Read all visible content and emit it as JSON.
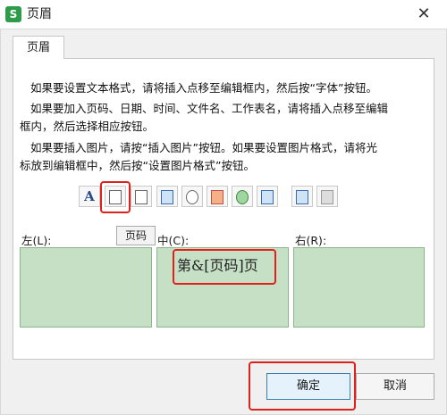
{
  "window": {
    "app_icon": "S",
    "title": "页眉",
    "close": "✕"
  },
  "tab": {
    "label": "页眉"
  },
  "instructions": [
    "如果要设置文本格式，请将插入点移至编辑框内，然后按“字体”按钮。",
    "如果要加入页码、日期、时间、文件名、工作表名，请将插入点移至编辑",
    "框内，然后选择相应按钮。",
    "如果要插入图片，请按“插入图片”按钮。如果要设置图片格式，请将光",
    "标放到编辑框中，然后按“设置图片格式”按钮。"
  ],
  "toolbar": {
    "font_glyph": "A",
    "icons": [
      "font-icon",
      "page-number-icon",
      "total-pages-icon",
      "date-icon",
      "time-icon",
      "file-path-icon",
      "file-name-icon",
      "sheet-name-icon",
      "insert-picture-icon",
      "format-picture-icon"
    ]
  },
  "tooltip": "页码",
  "sections": {
    "left_label": "左(L):",
    "center_label": "中(C):",
    "right_label": "右(R):",
    "center_content": "第&[页码]页",
    "left_content": "",
    "right_content": ""
  },
  "buttons": {
    "ok": "确定",
    "cancel": "取消"
  },
  "colors": {
    "highlight": "#e0201b",
    "edit_box": "#c6e0c6"
  }
}
